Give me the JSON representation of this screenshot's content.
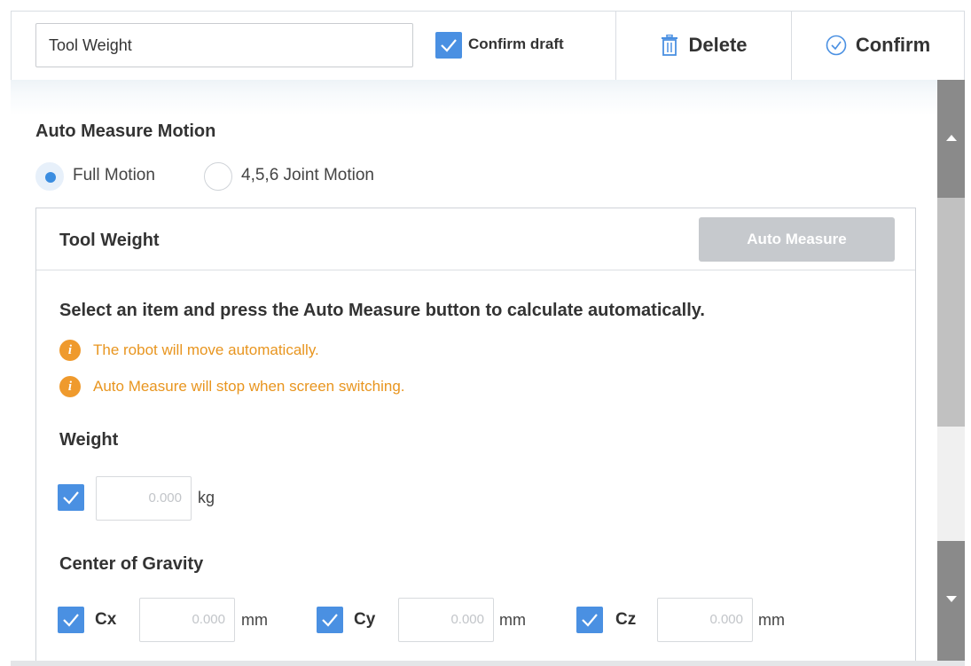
{
  "header": {
    "title_value": "Tool Weight",
    "confirm_draft_label": "Confirm draft",
    "confirm_draft_checked": true,
    "delete_label": "Delete",
    "confirm_label": "Confirm"
  },
  "motion": {
    "section_title": "Auto Measure Motion",
    "options": [
      {
        "label": "Full Motion",
        "selected": true
      },
      {
        "label": "4,5,6 Joint Motion",
        "selected": false
      }
    ]
  },
  "panel": {
    "title": "Tool Weight",
    "auto_measure_label": "Auto Measure",
    "instruction": "Select an item and press the Auto Measure button to calculate automatically.",
    "warnings": [
      "The robot will move automatically.",
      "Auto Measure will stop when screen switching."
    ],
    "weight": {
      "title": "Weight",
      "checked": true,
      "value": "0.000",
      "unit": "kg"
    },
    "cog": {
      "title": "Center of Gravity",
      "axes": [
        {
          "label": "Cx",
          "checked": true,
          "value": "0.000",
          "unit": "mm"
        },
        {
          "label": "Cy",
          "checked": true,
          "value": "0.000",
          "unit": "mm"
        },
        {
          "label": "Cz",
          "checked": true,
          "value": "0.000",
          "unit": "mm"
        }
      ]
    }
  },
  "colors": {
    "accent": "#4a90e2",
    "warning": "#e8951f",
    "disabled_button": "#c6c9cd"
  }
}
